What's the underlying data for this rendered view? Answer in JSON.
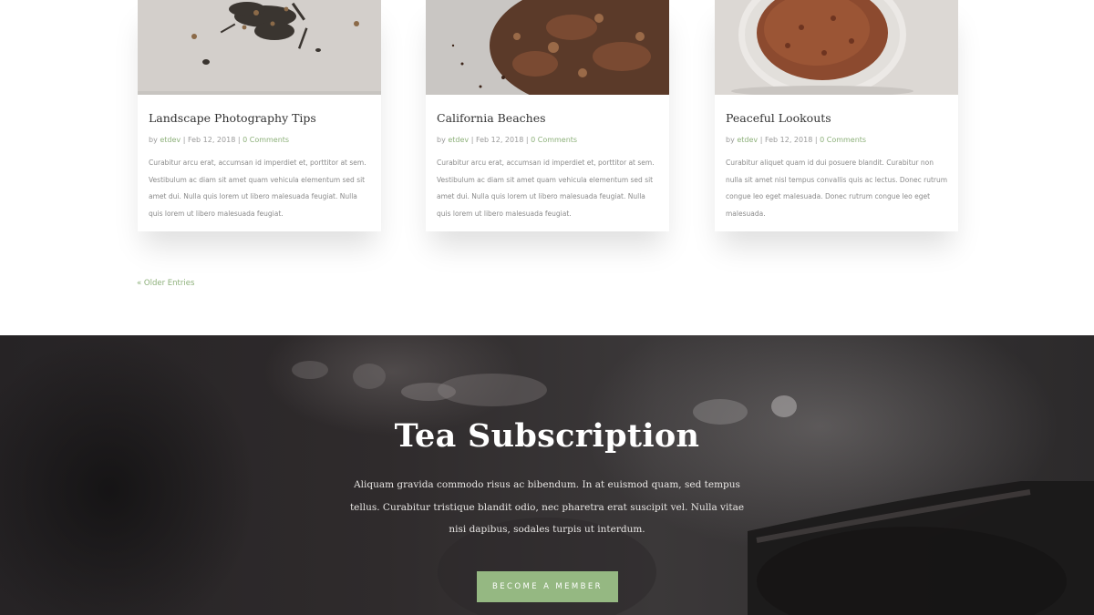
{
  "posts": [
    {
      "title": "Landscape Photography Tips",
      "meta_by": "by",
      "author": "etdev",
      "date": "Feb 12, 2018",
      "comments": "0 Comments",
      "excerpt": "Curabitur arcu erat, accumsan id imperdiet et, porttitor at sem. Vestibulum ac diam sit amet quam vehicula elementum sed sit amet dui. Nulla quis lorem ut libero malesuada feugiat. Nulla quis lorem ut libero malesuada feugiat.",
      "image": "loose-leaf-tea-photo"
    },
    {
      "title": "California Beaches",
      "meta_by": "by",
      "author": "etdev",
      "date": "Feb 12, 2018",
      "comments": "0 Comments",
      "excerpt": "Curabitur arcu erat, accumsan id imperdiet et, porttitor at sem. Vestibulum ac diam sit amet quam vehicula elementum sed sit amet dui. Nulla quis lorem ut libero malesuada feugiat. Nulla quis lorem ut libero malesuada feugiat.",
      "image": "herbal-tea-photo"
    },
    {
      "title": "Peaceful Lookouts",
      "meta_by": "by",
      "author": "etdev",
      "date": "Feb 12, 2018",
      "comments": "0 Comments",
      "excerpt": "Curabitur aliquet quam id dui posuere blandit. Curabitur non nulla sit amet nisl tempus convallis quis ac lectus. Donec rutrum congue leo eget malesuada. Donec rutrum congue leo eget malesuada.",
      "image": "rooibos-tea-bowl-photo"
    }
  ],
  "pagination": {
    "older_label": "« Older Entries"
  },
  "subscription": {
    "title": "Tea Subscription",
    "text": "Aliquam gravida commodo risus ac bibendum. In at euismod quam, sed tempus tellus. Curabitur tristique blandit odio, nec pharetra erat suscipit vel. Nulla vitae nisi dapibus, sodales turpis ut interdum.",
    "button_label": "BECOME A MEMBER",
    "background": "teapot-steam-photo"
  },
  "colors": {
    "accent": "#95b882",
    "link": "#8db07a",
    "hero_bg": "#2f2b2c",
    "text_dark": "#333333",
    "text_muted": "#8a8a8a"
  }
}
